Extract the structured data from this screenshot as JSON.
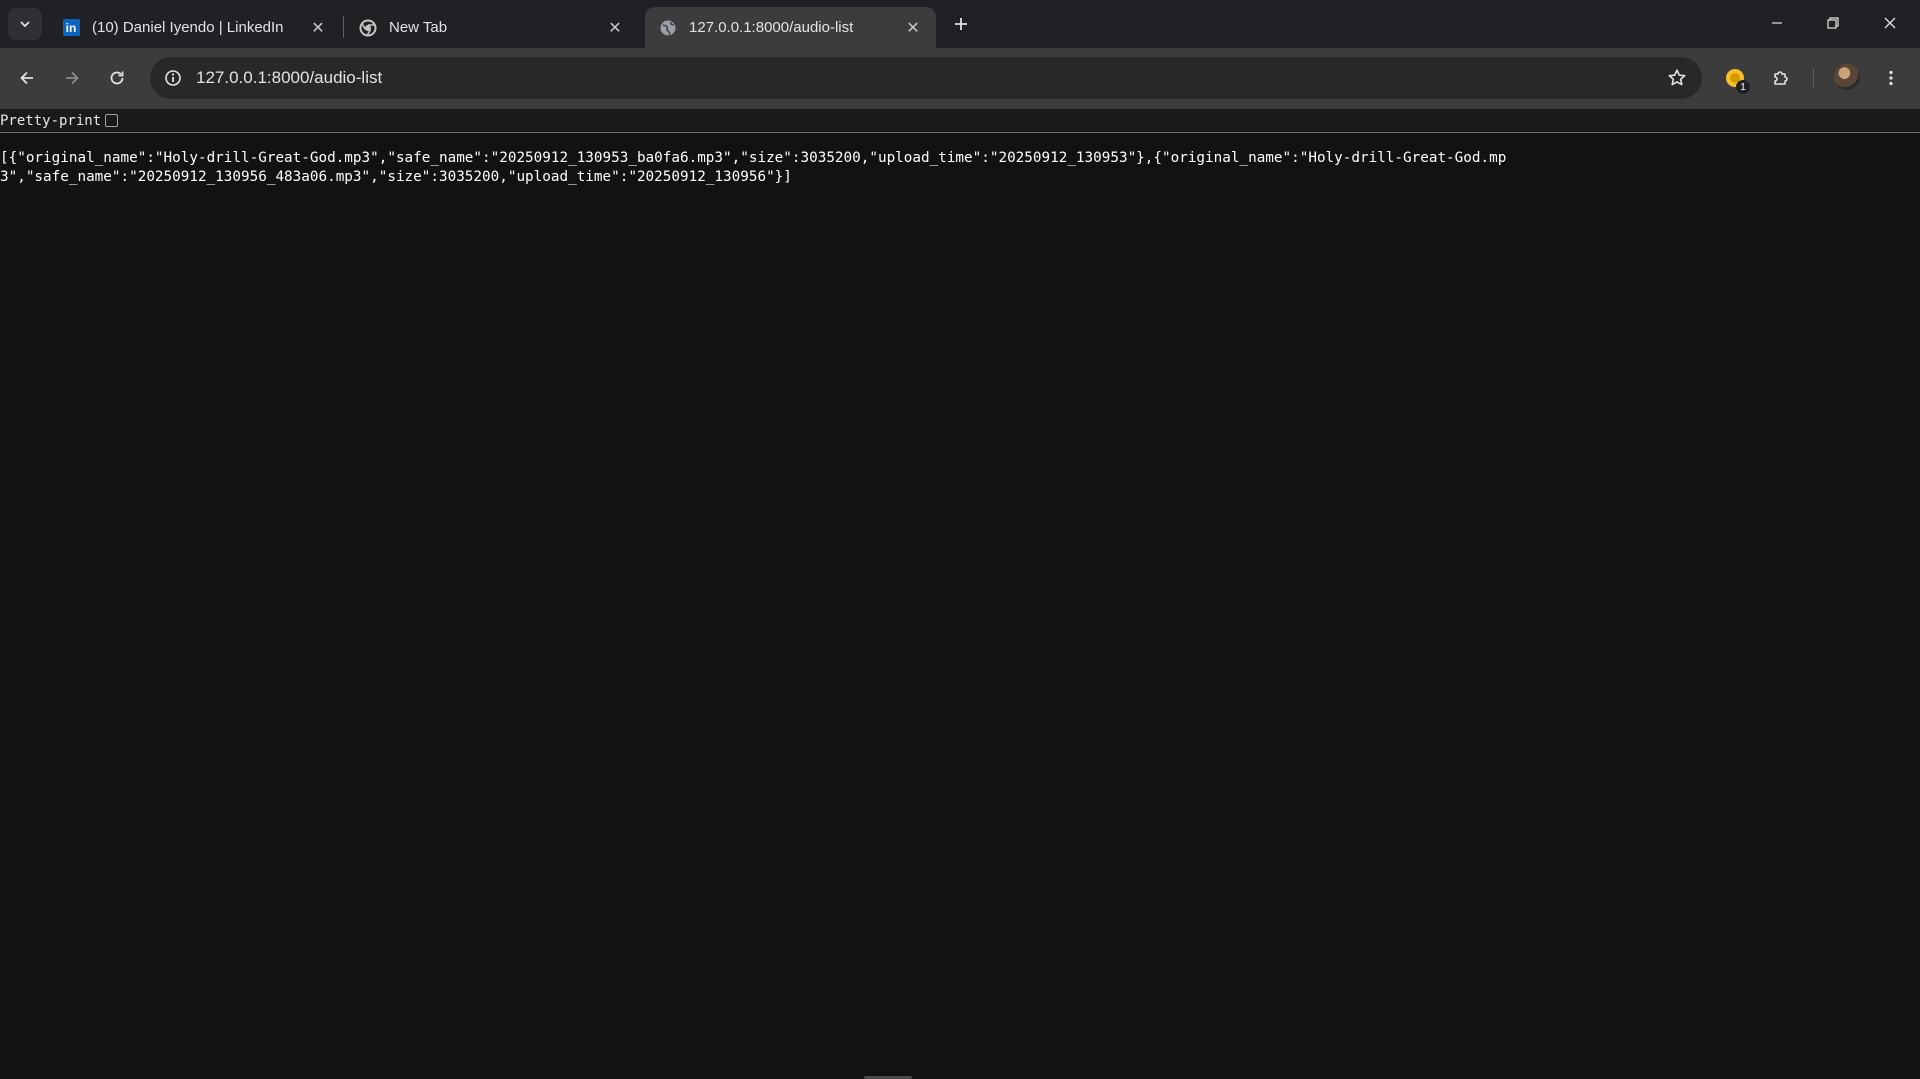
{
  "browser": {
    "tabs": [
      {
        "title": "(10) Daniel Iyendo | LinkedIn",
        "icon": "linkedin-icon",
        "active": false
      },
      {
        "title": "New Tab",
        "icon": "chrome-icon",
        "active": false
      },
      {
        "title": "127.0.0.1:8000/audio-list",
        "icon": "globe-icon",
        "active": true
      }
    ],
    "address": "127.0.0.1:8000/audio-list",
    "extension_badge": "1"
  },
  "page": {
    "pretty_print_label": "Pretty-print",
    "pretty_print_checked": false,
    "json_text": "[{\"original_name\":\"Holy-drill-Great-God.mp3\",\"safe_name\":\"20250912_130953_ba0fa6.mp3\",\"size\":3035200,\"upload_time\":\"20250912_130953\"},{\"original_name\":\"Holy-drill-Great-God.mp3\",\"safe_name\":\"20250912_130956_483a06.mp3\",\"size\":3035200,\"upload_time\":\"20250912_130956\"}]"
  },
  "colors": {
    "tabstrip_bg": "#202124",
    "toolbar_bg": "#3c3c3c",
    "page_bg": "#121212",
    "linkedin_blue": "#0a66c2",
    "extension_yellow": "#f6c02b"
  }
}
